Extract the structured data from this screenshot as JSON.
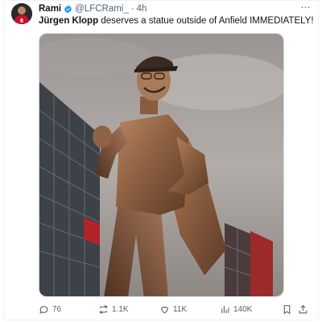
{
  "tweet": {
    "author": {
      "name": "Rami",
      "handle": "@LFCRami_",
      "separator": "·",
      "time": "4h",
      "verified": true,
      "avatar_jersey_number": "8"
    },
    "more_icon": "⋯",
    "text": {
      "bold_part": "Jürgen Klopp",
      "rest": " deserves a statue outside of Anfield IMMEDIATELY!"
    },
    "media": {
      "description_icon": "photo-statue"
    },
    "actions": {
      "replies": "76",
      "retweets": "1.1K",
      "likes": "11K",
      "views": "140K"
    },
    "colors": {
      "verified": "#1d9bf0",
      "muted": "#536471",
      "avatar_red": "#c8102e"
    }
  }
}
